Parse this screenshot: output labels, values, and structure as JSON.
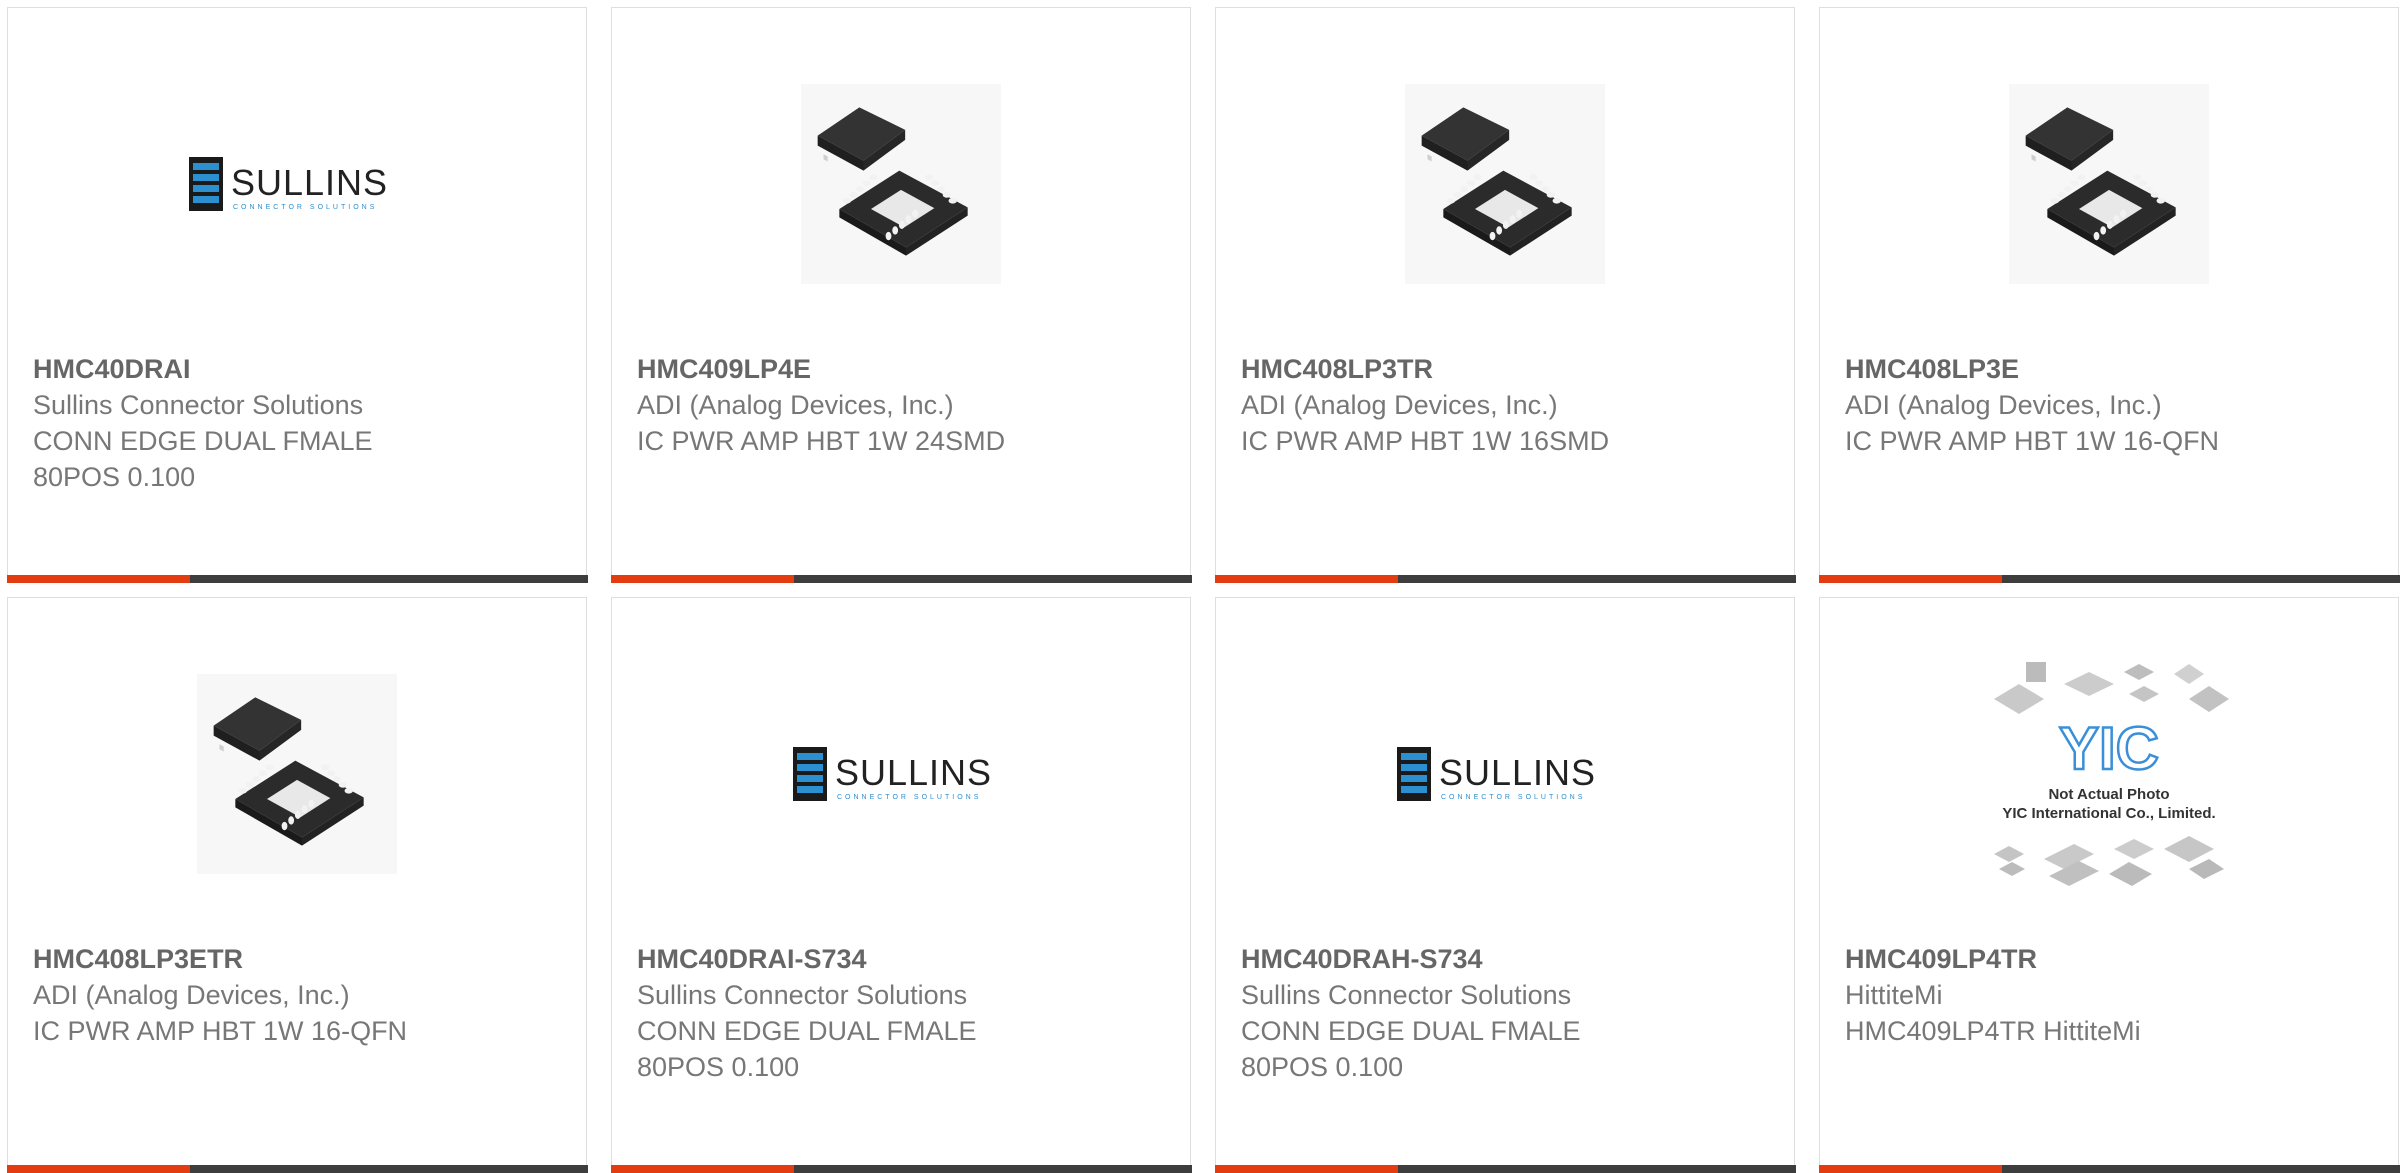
{
  "accent_color": "#e33c10",
  "bar_color": "#3d3d3d",
  "products": [
    {
      "part_number": "HMC40DRAI",
      "manufacturer": "Sullins Connector Solutions",
      "description": "CONN EDGE DUAL FMALE\n80POS 0.100",
      "image": "sullins-logo",
      "logo_text": "SULLINS",
      "logo_sub": "CONNECTOR SOLUTIONS"
    },
    {
      "part_number": "HMC409LP4E",
      "manufacturer": "ADI (Analog Devices, Inc.)",
      "description": "IC PWR AMP HBT 1W 24SMD",
      "image": "qfn-chip-photo"
    },
    {
      "part_number": "HMC408LP3TR",
      "manufacturer": "ADI (Analog Devices, Inc.)",
      "description": "IC PWR AMP HBT 1W 16SMD",
      "image": "qfn-chip-photo"
    },
    {
      "part_number": "HMC408LP3E",
      "manufacturer": "ADI (Analog Devices, Inc.)",
      "description": "IC PWR AMP HBT 1W 16-QFN",
      "image": "qfn-chip-photo"
    },
    {
      "part_number": "HMC408LP3ETR",
      "manufacturer": "ADI (Analog Devices, Inc.)",
      "description": "IC PWR AMP HBT 1W 16-QFN",
      "image": "qfn-chip-photo"
    },
    {
      "part_number": "HMC40DRAI-S734",
      "manufacturer": "Sullins Connector Solutions",
      "description": "CONN EDGE DUAL FMALE\n80POS 0.100",
      "image": "sullins-logo",
      "logo_text": "SULLINS",
      "logo_sub": "CONNECTOR SOLUTIONS"
    },
    {
      "part_number": "HMC40DRAH-S734",
      "manufacturer": "Sullins Connector Solutions",
      "description": "CONN EDGE DUAL FMALE\n80POS 0.100",
      "image": "sullins-logo",
      "logo_text": "SULLINS",
      "logo_sub": "CONNECTOR SOLUTIONS"
    },
    {
      "part_number": "HMC409LP4TR",
      "manufacturer": "HittiteMi",
      "description": "HMC409LP4TR HittiteMi",
      "image": "placeholder-photo",
      "placeholder_logo": "YIC",
      "placeholder_line1": "Not Actual Photo",
      "placeholder_line2": "YIC International Co., Limited."
    }
  ]
}
